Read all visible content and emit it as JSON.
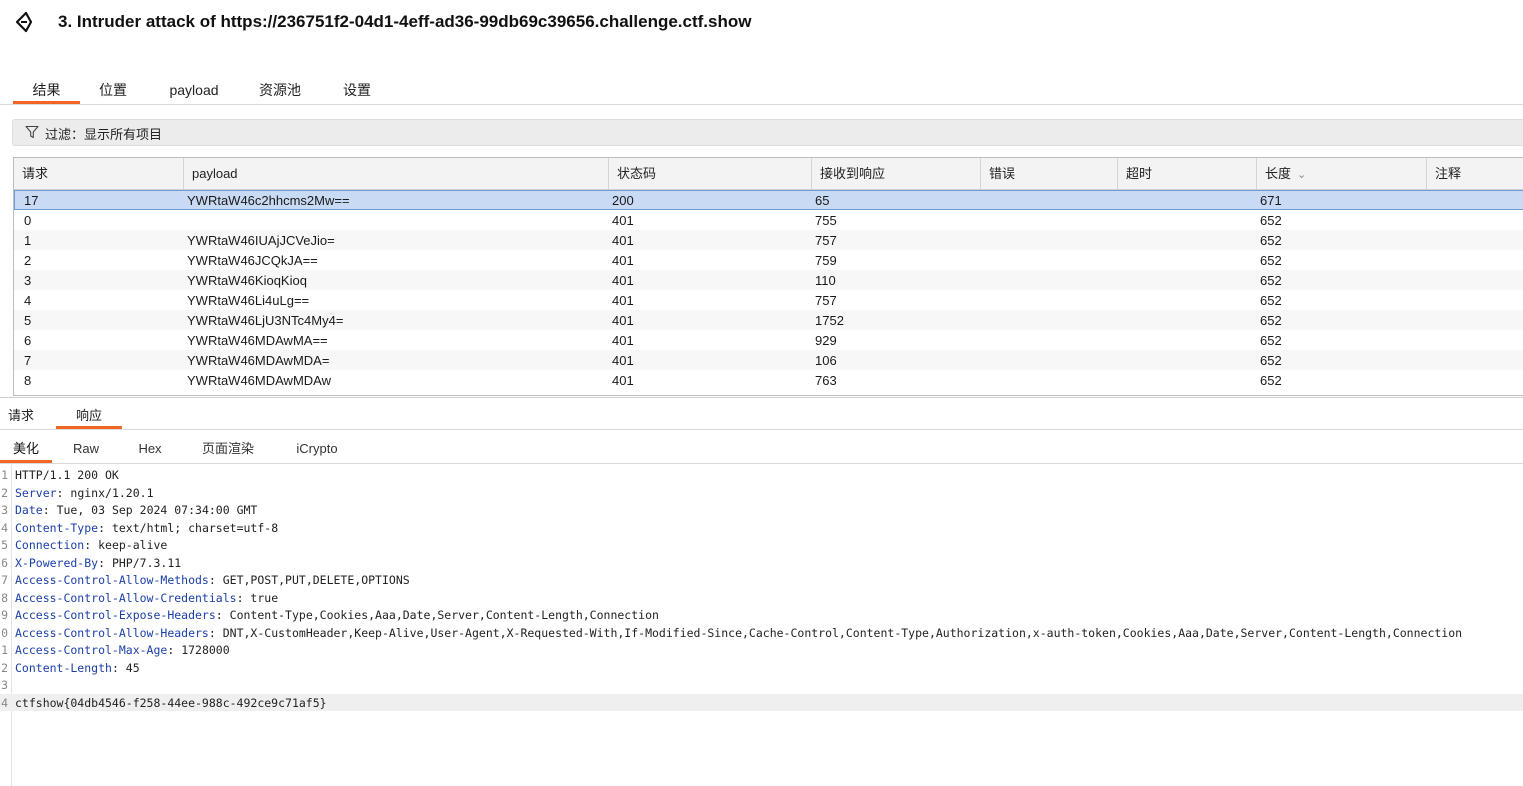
{
  "window": {
    "title": "3. Intruder attack of https://236751f2-04d1-4eff-ad36-99db69c39656.challenge.ctf.show"
  },
  "tabs": [
    {
      "label": "结果",
      "active": true
    },
    {
      "label": "位置",
      "active": false
    },
    {
      "label": "payload",
      "active": false
    },
    {
      "label": "资源池",
      "active": false
    },
    {
      "label": "设置",
      "active": false
    }
  ],
  "filter": {
    "label": "过滤：显示所有项目"
  },
  "table": {
    "columns": [
      "请求",
      "payload",
      "状态码",
      "接收到响应",
      "错误",
      "超时",
      "长度",
      "注释"
    ],
    "sort_column": "长度",
    "rows": [
      {
        "req": "17",
        "payload": "YWRtaW46c2hhcms2Mw==",
        "status": "200",
        "resp": "65",
        "error": "",
        "timeout": "",
        "length": "671",
        "comment": "",
        "selected": true
      },
      {
        "req": "0",
        "payload": "",
        "status": "401",
        "resp": "755",
        "error": "",
        "timeout": "",
        "length": "652",
        "comment": ""
      },
      {
        "req": "1",
        "payload": "YWRtaW46IUAjJCVeJio=",
        "status": "401",
        "resp": "757",
        "error": "",
        "timeout": "",
        "length": "652",
        "comment": ""
      },
      {
        "req": "2",
        "payload": "YWRtaW46JCQkJA==",
        "status": "401",
        "resp": "759",
        "error": "",
        "timeout": "",
        "length": "652",
        "comment": ""
      },
      {
        "req": "3",
        "payload": "YWRtaW46KioqKioq",
        "status": "401",
        "resp": "110",
        "error": "",
        "timeout": "",
        "length": "652",
        "comment": ""
      },
      {
        "req": "4",
        "payload": "YWRtaW46Li4uLg==",
        "status": "401",
        "resp": "757",
        "error": "",
        "timeout": "",
        "length": "652",
        "comment": ""
      },
      {
        "req": "5",
        "payload": "YWRtaW46LjU3NTc4My4=",
        "status": "401",
        "resp": "1752",
        "error": "",
        "timeout": "",
        "length": "652",
        "comment": ""
      },
      {
        "req": "6",
        "payload": "YWRtaW46MDAwMA==",
        "status": "401",
        "resp": "929",
        "error": "",
        "timeout": "",
        "length": "652",
        "comment": ""
      },
      {
        "req": "7",
        "payload": "YWRtaW46MDAwMDA=",
        "status": "401",
        "resp": "106",
        "error": "",
        "timeout": "",
        "length": "652",
        "comment": ""
      },
      {
        "req": "8",
        "payload": "YWRtaW46MDAwMDAw",
        "status": "401",
        "resp": "763",
        "error": "",
        "timeout": "",
        "length": "652",
        "comment": ""
      }
    ]
  },
  "req_resp_tabs": [
    {
      "label": "请求",
      "active": false
    },
    {
      "label": "响应",
      "active": true
    }
  ],
  "view_tabs": [
    {
      "label": "美化",
      "active": true
    },
    {
      "label": "Raw",
      "active": false
    },
    {
      "label": "Hex",
      "active": false
    },
    {
      "label": "页面渲染",
      "active": false
    },
    {
      "label": "iCrypto",
      "active": false
    }
  ],
  "response": {
    "lines": [
      {
        "n": "1",
        "key": "",
        "sep": "",
        "text": "HTTP/1.1 200 OK"
      },
      {
        "n": "2",
        "key": "Server",
        "sep": ": ",
        "text": "nginx/1.20.1"
      },
      {
        "n": "3",
        "key": "Date",
        "sep": ": ",
        "text": "Tue, 03 Sep 2024 07:34:00 GMT"
      },
      {
        "n": "4",
        "key": "Content-Type",
        "sep": ": ",
        "text": "text/html; charset=utf-8"
      },
      {
        "n": "5",
        "key": "Connection",
        "sep": ": ",
        "text": "keep-alive"
      },
      {
        "n": "6",
        "key": "X-Powered-By",
        "sep": ": ",
        "text": "PHP/7.3.11"
      },
      {
        "n": "7",
        "key": "Access-Control-Allow-Methods",
        "sep": ": ",
        "text": "GET,POST,PUT,DELETE,OPTIONS"
      },
      {
        "n": "8",
        "key": "Access-Control-Allow-Credentials",
        "sep": ": ",
        "text": "true"
      },
      {
        "n": "9",
        "key": "Access-Control-Expose-Headers",
        "sep": ": ",
        "text": "Content-Type,Cookies,Aaa,Date,Server,Content-Length,Connection"
      },
      {
        "n": "0",
        "key": "Access-Control-Allow-Headers",
        "sep": ": ",
        "text": "DNT,X-CustomHeader,Keep-Alive,User-Agent,X-Requested-With,If-Modified-Since,Cache-Control,Content-Type,Authorization,x-auth-token,Cookies,Aaa,Date,Server,Content-Length,Connection"
      },
      {
        "n": "1",
        "key": "Access-Control-Max-Age",
        "sep": ": ",
        "text": "1728000"
      },
      {
        "n": "2",
        "key": "Content-Length",
        "sep": ": ",
        "text": "45"
      },
      {
        "n": "3",
        "key": "",
        "sep": "",
        "text": ""
      },
      {
        "n": "4",
        "key": "",
        "sep": "",
        "text": "ctfshow{04db4546-f258-44ee-988c-492ce9c71af5}",
        "highlight": true
      }
    ]
  },
  "colors": {
    "accent": "#f26522",
    "selected_row": "#c8daf4",
    "header_key": "#1b3fa8"
  }
}
